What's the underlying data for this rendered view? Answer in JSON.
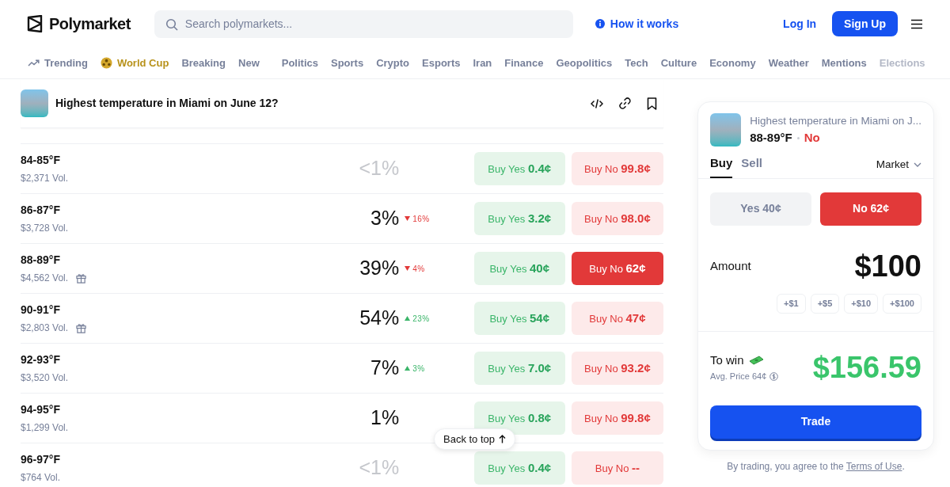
{
  "header": {
    "logo": "Polymarket",
    "search": {
      "placeholder": "Search polymarkets..."
    },
    "how_it_works": "How it works",
    "log_in": "Log In",
    "sign_up": "Sign Up"
  },
  "nav_primary": [
    {
      "label": "Trending",
      "kind": "trending"
    },
    {
      "label": "World Cup",
      "kind": "featured"
    },
    {
      "label": "Breaking",
      "kind": "plain"
    },
    {
      "label": "New",
      "kind": "plain"
    }
  ],
  "nav_categories": [
    "Politics",
    "Sports",
    "Crypto",
    "Esports",
    "Iran",
    "Finance",
    "Geopolitics",
    "Tech",
    "Culture",
    "Economy",
    "Weather",
    "Mentions",
    "Elections"
  ],
  "market": {
    "title": "Highest temperature in Miami on June 12?"
  },
  "rows": [
    {
      "range": "84-85°F",
      "volume": "$2,371 Vol.",
      "gift": false,
      "chance": "<1%",
      "muted": true,
      "change": null,
      "yes": {
        "label": "Buy Yes",
        "price": "0.4¢"
      },
      "no": {
        "label": "Buy No",
        "price": "99.8¢",
        "selected": false
      }
    },
    {
      "range": "86-87°F",
      "volume": "$3,728 Vol.",
      "gift": false,
      "chance": "3%",
      "muted": false,
      "change": {
        "kind": "down",
        "value": "16%"
      },
      "yes": {
        "label": "Buy Yes",
        "price": "3.2¢"
      },
      "no": {
        "label": "Buy No",
        "price": "98.0¢",
        "selected": false
      }
    },
    {
      "range": "88-89°F",
      "volume": "$4,562 Vol.",
      "gift": true,
      "chance": "39%",
      "muted": false,
      "change": {
        "kind": "down",
        "value": "4%"
      },
      "yes": {
        "label": "Buy Yes",
        "price": "40¢"
      },
      "no": {
        "label": "Buy No",
        "price": "62¢",
        "selected": true
      }
    },
    {
      "range": "90-91°F",
      "volume": "$2,803 Vol.",
      "gift": true,
      "chance": "54%",
      "muted": false,
      "change": {
        "kind": "up",
        "value": "23%"
      },
      "yes": {
        "label": "Buy Yes",
        "price": "54¢"
      },
      "no": {
        "label": "Buy No",
        "price": "47¢",
        "selected": false
      }
    },
    {
      "range": "92-93°F",
      "volume": "$3,520 Vol.",
      "gift": false,
      "chance": "7%",
      "muted": false,
      "change": {
        "kind": "up",
        "value": "3%"
      },
      "yes": {
        "label": "Buy Yes",
        "price": "7.0¢"
      },
      "no": {
        "label": "Buy No",
        "price": "93.2¢",
        "selected": false
      }
    },
    {
      "range": "94-95°F",
      "volume": "$1,299 Vol.",
      "gift": false,
      "chance": "1%",
      "muted": false,
      "change": null,
      "yes": {
        "label": "Buy Yes",
        "price": "0.8¢"
      },
      "no": {
        "label": "Buy No",
        "price": "99.8¢",
        "selected": false
      }
    },
    {
      "range": "96-97°F",
      "volume": "$764 Vol.",
      "gift": false,
      "chance": "<1%",
      "muted": true,
      "change": null,
      "yes": {
        "label": "Buy Yes",
        "price": "0.4¢"
      },
      "no": {
        "label": "Buy No",
        "price": "--",
        "selected": false
      }
    }
  ],
  "back_to_top": "Back to top",
  "trade_panel": {
    "title": "Highest temperature in Miami on J...",
    "outcome": "88-89°F",
    "side": "No",
    "tabs": [
      {
        "label": "Buy",
        "selected": true
      },
      {
        "label": "Sell",
        "selected": false
      }
    ],
    "order_type": "Market",
    "outcomes": [
      {
        "label": "Yes",
        "price": "40¢",
        "selected": false
      },
      {
        "label": "No",
        "price": "62¢",
        "selected": true
      }
    ],
    "amount_label": "Amount",
    "amount": "$100",
    "quick_amounts": [
      "+$1",
      "+$5",
      "+$10",
      "+$100"
    ],
    "to_win_label": "To win",
    "avg_price": "Avg. Price 64¢",
    "payout": "$156.59",
    "trade_button": "Trade",
    "disclaimer": "By trading, you agree to the",
    "terms_link": "Terms of Use",
    "disclaimer_end": "."
  }
}
